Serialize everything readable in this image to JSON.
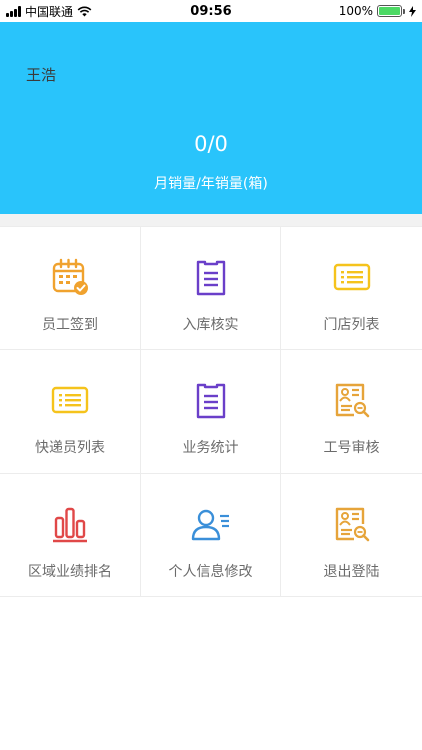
{
  "status_bar": {
    "carrier": "中国联通",
    "time": "09:56",
    "battery": "100%",
    "battery_level": 1.0,
    "icons": [
      "signal-icon",
      "wifi-icon",
      "battery-icon",
      "charging-icon"
    ]
  },
  "header": {
    "user_name": "王浩",
    "sales_value": "0/0",
    "sales_label": "月销量/年销量(箱)",
    "background_color": "#29c4fb"
  },
  "menu": {
    "items": [
      {
        "label": "员工签到",
        "icon": "calendar-check-icon",
        "color": "#f0a22e"
      },
      {
        "label": "入库核实",
        "icon": "clipboard-icon",
        "color": "#6a3fc9"
      },
      {
        "label": "门店列表",
        "icon": "list-card-icon",
        "color": "#f5c31c"
      },
      {
        "label": "快递员列表",
        "icon": "list-card-icon",
        "color": "#f5c31c"
      },
      {
        "label": "业务统计",
        "icon": "clipboard-icon",
        "color": "#6a3fc9"
      },
      {
        "label": "工号审核",
        "icon": "id-card-search-icon",
        "color": "#e6a43a"
      },
      {
        "label": "区域业绩排名",
        "icon": "bar-chart-icon",
        "color": "#e04848"
      },
      {
        "label": "个人信息修改",
        "icon": "user-edit-icon",
        "color": "#3a8fd9"
      },
      {
        "label": "退出登陆",
        "icon": "id-card-search-icon",
        "color": "#e6a43a"
      }
    ]
  }
}
